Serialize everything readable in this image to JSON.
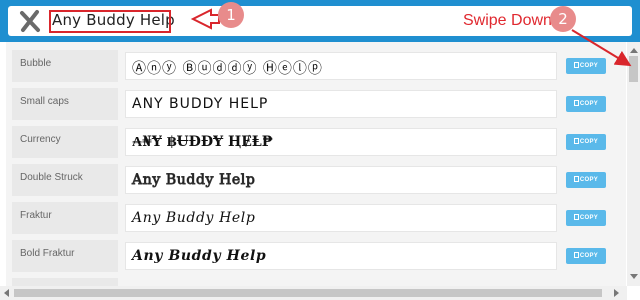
{
  "search": {
    "value": "Any Buddy Help"
  },
  "annotations": {
    "step1": "1",
    "step2": "2",
    "swipe_text": "Swipe Down",
    "color": "#d9262c"
  },
  "copy_label": "COPY",
  "rows": [
    {
      "label": "Bubble",
      "value": "Ⓐⓝⓨ Ⓑⓤⓓⓓⓨ Ⓗⓔⓛⓟ"
    },
    {
      "label": "Small caps",
      "value": "ANY BUDDY HELP"
    },
    {
      "label": "Currency",
      "value": "₳₦Ɏ ฿ɄĐĐɎ ⱧɆⱠ₱"
    },
    {
      "label": "Double Struck",
      "value": "Any Buddy Help"
    },
    {
      "label": "Fraktur",
      "value": "Any Buddy Help"
    },
    {
      "label": "Bold Fraktur",
      "value": "Any Buddy Help"
    }
  ],
  "icons": {
    "clear": "close-x-icon",
    "copy": "clipboard-icon"
  },
  "colors": {
    "header": "#1f8fd0",
    "copy_button": "#5ab9ea",
    "annotation_badge": "#e88b8b"
  }
}
